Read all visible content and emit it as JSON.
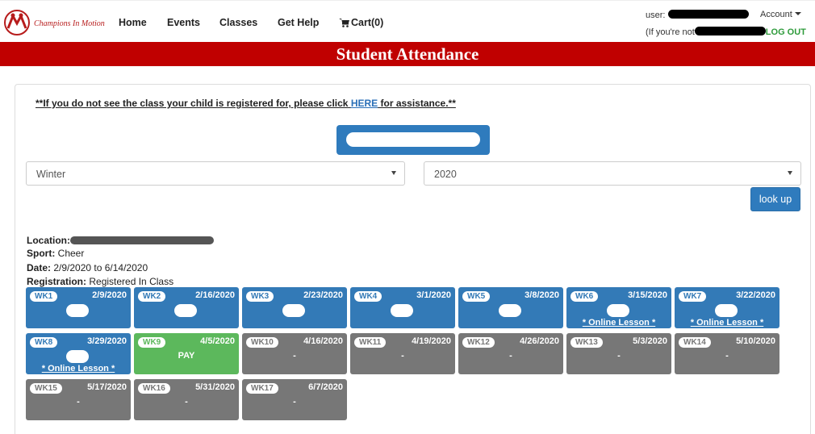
{
  "nav": {
    "brand": "Champions In Motion",
    "links": [
      "Home",
      "Events",
      "Classes",
      "Get Help"
    ],
    "cart": "Cart(0)",
    "user_label": "user:",
    "account": "Account",
    "not_you": "(If you're not",
    "logout": "LOG OUT"
  },
  "page": {
    "title": "Student Attendance"
  },
  "notice": {
    "prefix": "**If you do not see the class your child is registered for, please click ",
    "link": "HERE",
    "suffix": " for assistance.**"
  },
  "filters": {
    "season": "Winter",
    "year": "2020",
    "lookup": "look up"
  },
  "details": {
    "location_label": "Location:",
    "sport_label": "Sport:",
    "sport": "Cheer",
    "date_label": "Date:",
    "date": "2/9/2020 to 6/14/2020",
    "registration_label": "Registration:",
    "registration": "Registered In Class"
  },
  "weeks": [
    {
      "wk": "WK1",
      "date": "2/9/2020",
      "color": "blue",
      "blob": true,
      "text": ""
    },
    {
      "wk": "WK2",
      "date": "2/16/2020",
      "color": "blue",
      "blob": true,
      "text": ""
    },
    {
      "wk": "WK3",
      "date": "2/23/2020",
      "color": "blue",
      "blob": true,
      "text": ""
    },
    {
      "wk": "WK4",
      "date": "3/1/2020",
      "color": "blue",
      "blob": true,
      "text": ""
    },
    {
      "wk": "WK5",
      "date": "3/8/2020",
      "color": "blue",
      "blob": true,
      "text": ""
    },
    {
      "wk": "WK6",
      "date": "3/15/2020",
      "color": "blue",
      "blob": true,
      "text": "* Online Lesson *"
    },
    {
      "wk": "WK7",
      "date": "3/22/2020",
      "color": "blue",
      "blob": true,
      "text": "* Online Lesson *"
    },
    {
      "wk": "WK8",
      "date": "3/29/2020",
      "color": "blue",
      "blob": true,
      "text": "* Online Lesson *"
    },
    {
      "wk": "WK9",
      "date": "4/5/2020",
      "color": "green",
      "blob": false,
      "text": "PAY"
    },
    {
      "wk": "WK10",
      "date": "4/16/2020",
      "color": "gray",
      "blob": false,
      "text": "-"
    },
    {
      "wk": "WK11",
      "date": "4/19/2020",
      "color": "gray",
      "blob": false,
      "text": "-"
    },
    {
      "wk": "WK12",
      "date": "4/26/2020",
      "color": "gray",
      "blob": false,
      "text": "-"
    },
    {
      "wk": "WK13",
      "date": "5/3/2020",
      "color": "gray",
      "blob": false,
      "text": "-"
    },
    {
      "wk": "WK14",
      "date": "5/10/2020",
      "color": "gray",
      "blob": false,
      "text": "-"
    },
    {
      "wk": "WK15",
      "date": "5/17/2020",
      "color": "gray",
      "blob": false,
      "text": "-"
    },
    {
      "wk": "WK16",
      "date": "5/31/2020",
      "color": "gray",
      "blob": false,
      "text": "-"
    },
    {
      "wk": "WK17",
      "date": "6/7/2020",
      "color": "gray",
      "blob": false,
      "text": "-"
    }
  ],
  "colors": {
    "brand_red": "#c00000",
    "primary_blue": "#337ab7",
    "success_green": "#5cb85c",
    "gray": "#777777",
    "logout_green": "#2e9b3b"
  }
}
